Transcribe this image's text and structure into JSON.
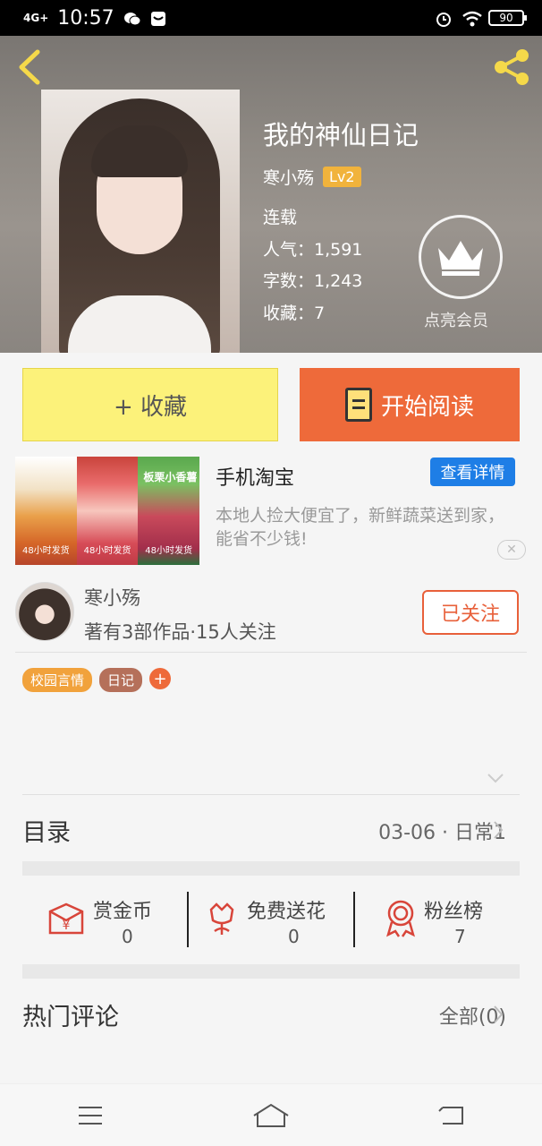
{
  "status_bar": {
    "network": "4G+",
    "time": "10:57",
    "battery": "90"
  },
  "book": {
    "title": "我的神仙日记",
    "author": "寒小殇",
    "author_level": "Lv2",
    "status": "连载",
    "popularity": "人气：1,591",
    "word_count": "字数：1,243",
    "favorites": "收藏：7",
    "vip_label": "点亮会员"
  },
  "actions": {
    "favorite_label": "+ 收藏",
    "read_label": "开始阅读"
  },
  "ad": {
    "title": "手机淘宝",
    "detail_label": "查看详情",
    "description": "本地人捡大便宜了，新鲜蔬菜送到家，能省不少钱!",
    "close_label": "✕",
    "image_tag_1": "48小时发货",
    "image_tag_2": "48小时发货",
    "image_tag_3": "48小时发货",
    "image_header_3": "板栗小香薯"
  },
  "author_card": {
    "name": "寒小殇",
    "stats": "著有3部作品·15人关注",
    "follow_label": "已关注"
  },
  "tags": [
    "校园言情",
    "日记",
    "+"
  ],
  "toc": {
    "label": "目录",
    "latest": "03-06 · 日常1"
  },
  "stats": {
    "coins_label": "赏金币",
    "coins_value": "0",
    "flowers_label": "免费送花",
    "flowers_value": "0",
    "fans_label": "粉丝榜",
    "fans_value": "7"
  },
  "comments": {
    "label": "热门评论",
    "all": "全部(0)"
  },
  "colors": {
    "accent_orange": "#ee6a3a",
    "favorite_yellow": "#fcf27a",
    "detail_blue": "#1e7ee6",
    "level_gold": "#f1b33c",
    "tag_orange": "#f1a23c",
    "tag_brown": "#b5705a"
  }
}
